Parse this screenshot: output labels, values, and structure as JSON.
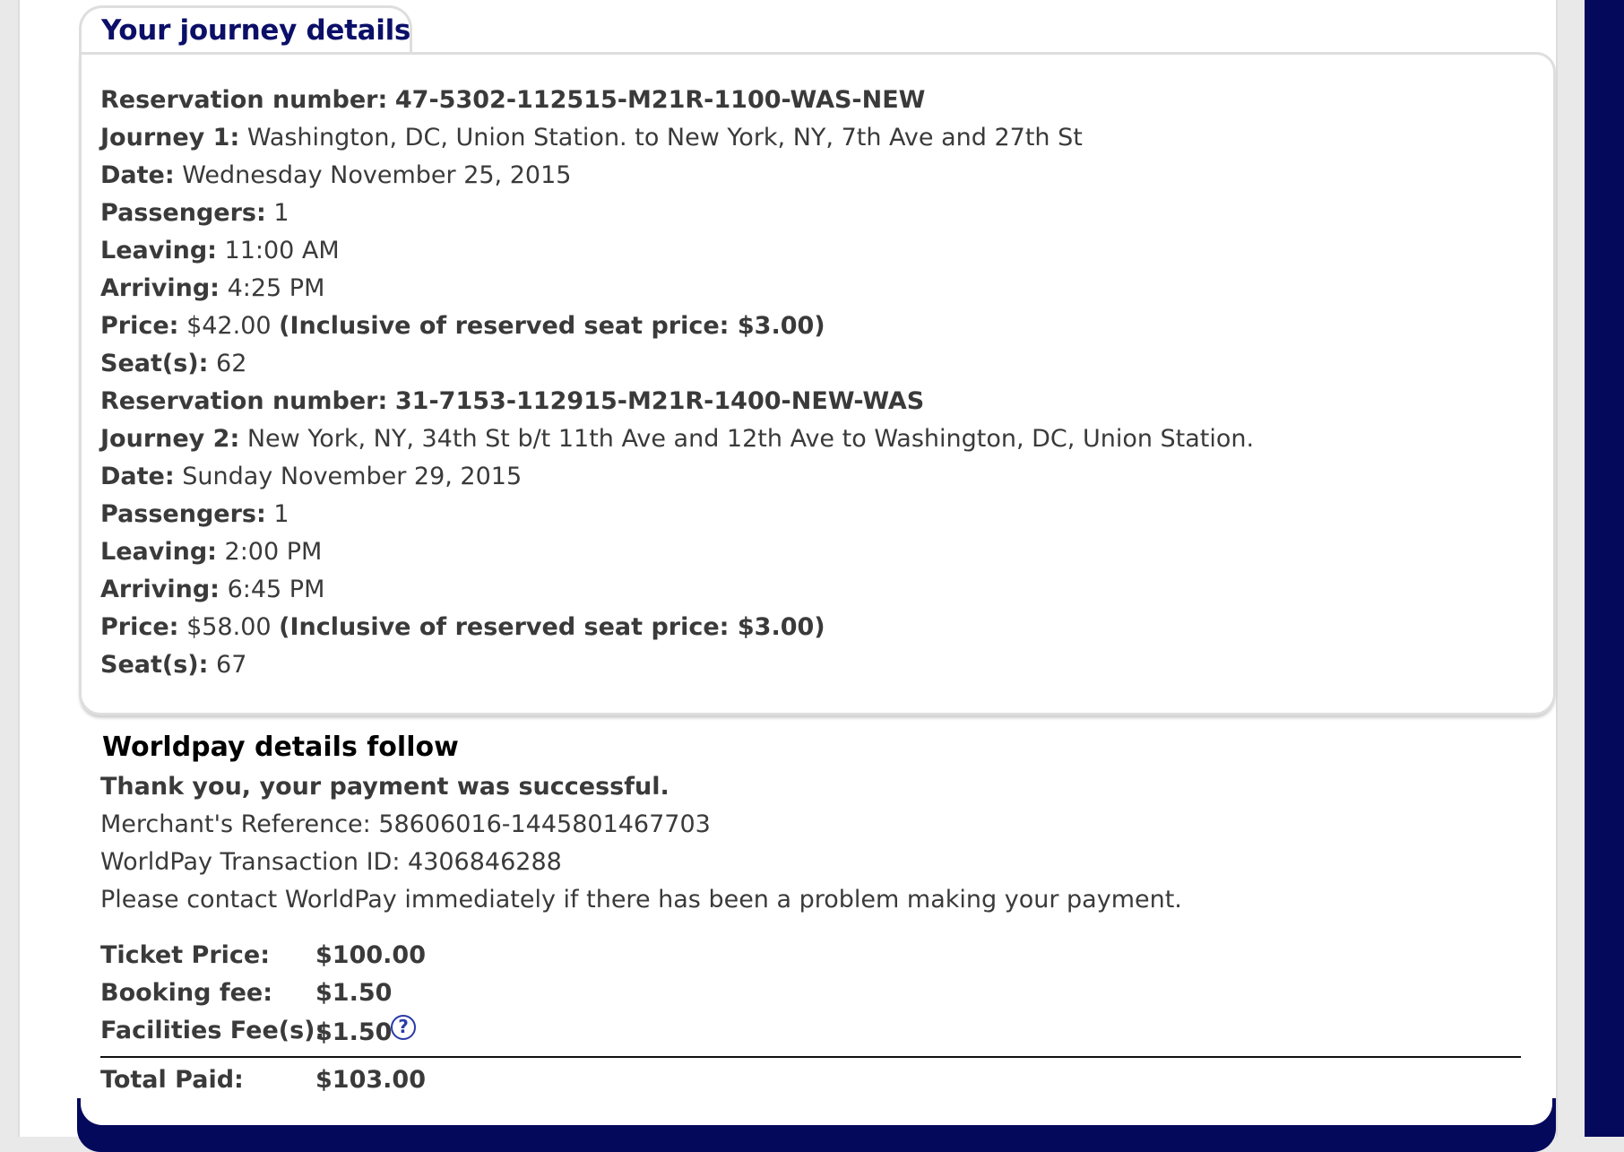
{
  "tab_title": "Your journey details",
  "journeys": [
    {
      "reservation_label": "Reservation number:",
      "reservation_number": "47-5302-112515-M21R-1100-WAS-NEW",
      "journey_label": "Journey 1:",
      "journey_value": "Washington, DC, Union Station. to New York, NY, 7th Ave and 27th St",
      "date_label": "Date:",
      "date_value": "Wednesday November 25, 2015",
      "passengers_label": "Passengers:",
      "passengers_value": "1",
      "leaving_label": "Leaving:",
      "leaving_value": "11:00 AM",
      "arriving_label": "Arriving:",
      "arriving_value": "4:25 PM",
      "price_label": "Price:",
      "price_value": "$42.00",
      "price_note": "(Inclusive of reserved seat price: $3.00)",
      "seats_label": "Seat(s):",
      "seats_value": "62"
    },
    {
      "reservation_label": "Reservation number:",
      "reservation_number": "31-7153-112915-M21R-1400-NEW-WAS",
      "journey_label": "Journey 2:",
      "journey_value": "New York, NY, 34th St b/t 11th Ave and 12th Ave to Washington, DC, Union Station.",
      "date_label": "Date:",
      "date_value": "Sunday November 29, 2015",
      "passengers_label": "Passengers:",
      "passengers_value": "1",
      "leaving_label": "Leaving:",
      "leaving_value": "2:00 PM",
      "arriving_label": "Arriving:",
      "arriving_value": "6:45 PM",
      "price_label": "Price:",
      "price_value": "$58.00",
      "price_note": "(Inclusive of reserved seat price: $3.00)",
      "seats_label": "Seat(s):",
      "seats_value": "67"
    }
  ],
  "worldpay": {
    "title": "Worldpay details follow",
    "success": "Thank you, your payment was successful.",
    "merchant_ref": "Merchant's Reference: 58606016-1445801467703",
    "transaction_id": "WorldPay Transaction ID: 4306846288",
    "contact_note": "Please contact WorldPay immediately if there has been a problem making your payment."
  },
  "fees": {
    "ticket_price_label": "Ticket Price:",
    "ticket_price_value": "$100.00",
    "booking_fee_label": "Booking fee:",
    "booking_fee_value": "$1.50",
    "facilities_fee_label": "Facilities Fee(s):",
    "facilities_fee_value": "$1.50",
    "help_glyph": "?",
    "total_label": "Total Paid:",
    "total_value": "$103.00"
  },
  "colors": {
    "navy": "#05095c",
    "title_blue": "#0b0f68",
    "help_blue": "#2a3ba8"
  },
  "icons": {
    "facilities_help": "question-circle-icon"
  }
}
